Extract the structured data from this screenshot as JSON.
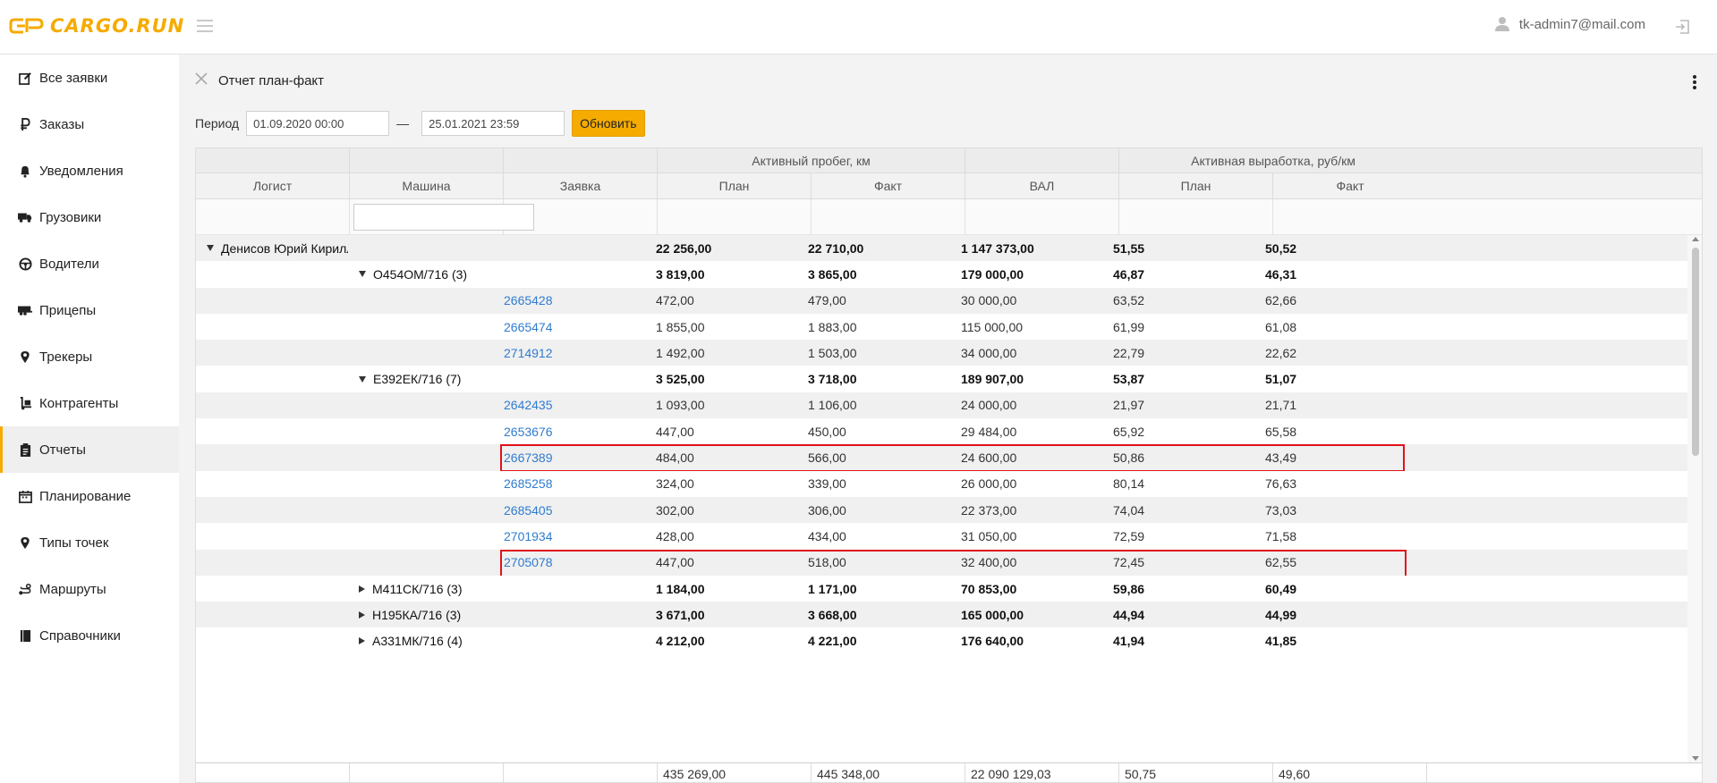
{
  "app": {
    "logo_text": "CARGO.RUN",
    "accent_color": "#f5ab00",
    "user_email": "tk-admin7@mail.com"
  },
  "sidebar": {
    "items": [
      {
        "label": "Все заявки",
        "icon": "edit-icon"
      },
      {
        "label": "Заказы",
        "icon": "ruble-icon"
      },
      {
        "label": "Уведомления",
        "icon": "bell-icon"
      },
      {
        "label": "Грузовики",
        "icon": "truck-icon"
      },
      {
        "label": "Водители",
        "icon": "steering-wheel-icon"
      },
      {
        "label": "Прицепы",
        "icon": "trailer-icon"
      },
      {
        "label": "Трекеры",
        "icon": "map-pin-icon"
      },
      {
        "label": "Контрагенты",
        "icon": "dolly-icon"
      },
      {
        "label": "Отчеты",
        "icon": "clipboard-icon",
        "active": true
      },
      {
        "label": "Планирование",
        "icon": "calendar-icon"
      },
      {
        "label": "Типы точек",
        "icon": "map-pin-icon"
      },
      {
        "label": "Маршруты",
        "icon": "route-icon"
      },
      {
        "label": "Справочники",
        "icon": "book-icon"
      }
    ]
  },
  "report": {
    "title": "Отчет план-факт",
    "period_label": "Период",
    "date_from": "01.09.2020 00:00",
    "date_to": "25.01.2021 23:59",
    "dash": "—",
    "refresh_label": "Обновить"
  },
  "grid": {
    "group_headers": {
      "mileage": "Активный пробег, км",
      "output": "Активная выработка, руб/км"
    },
    "columns": [
      "Логист",
      "Машина",
      "Заявка",
      "План",
      "Факт",
      "ВАЛ",
      "План",
      "Факт"
    ],
    "rows": [
      {
        "level": 0,
        "name": "Денисов Юрий Кириллович",
        "plan": "22 256,00",
        "fact": "22 710,00",
        "val": "1 147 373,00",
        "out_plan": "51,55",
        "out_fact": "50,52"
      },
      {
        "level": 1,
        "name": "О454ОМ/716 (3)",
        "expanded": true,
        "plan": "3 819,00",
        "fact": "3 865,00",
        "val": "179 000,00",
        "out_plan": "46,87",
        "out_fact": "46,31"
      },
      {
        "level": 2,
        "order": "2665428",
        "plan": "472,00",
        "fact": "479,00",
        "val": "30 000,00",
        "out_plan": "63,52",
        "out_fact": "62,66"
      },
      {
        "level": 2,
        "order": "2665474",
        "plan": "1 855,00",
        "fact": "1 883,00",
        "val": "115 000,00",
        "out_plan": "61,99",
        "out_fact": "61,08"
      },
      {
        "level": 2,
        "order": "2714912",
        "plan": "1 492,00",
        "fact": "1 503,00",
        "val": "34 000,00",
        "out_plan": "22,79",
        "out_fact": "22,62"
      },
      {
        "level": 1,
        "name": "Е392ЕК/716 (7)",
        "expanded": true,
        "plan": "3 525,00",
        "fact": "3 718,00",
        "val": "189 907,00",
        "out_plan": "53,87",
        "out_fact": "51,07"
      },
      {
        "level": 2,
        "order": "2642435",
        "plan": "1 093,00",
        "fact": "1 106,00",
        "val": "24 000,00",
        "out_plan": "21,97",
        "out_fact": "21,71"
      },
      {
        "level": 2,
        "order": "2653676",
        "plan": "447,00",
        "fact": "450,00",
        "val": "29 484,00",
        "out_plan": "65,92",
        "out_fact": "65,58"
      },
      {
        "level": 2,
        "order": "2667389",
        "highlighted": true,
        "plan": "484,00",
        "fact": "566,00",
        "val": "24 600,00",
        "out_plan": "50,86",
        "out_fact": "43,49"
      },
      {
        "level": 2,
        "order": "2685258",
        "plan": "324,00",
        "fact": "339,00",
        "val": "26 000,00",
        "out_plan": "80,14",
        "out_fact": "76,63"
      },
      {
        "level": 2,
        "order": "2685405",
        "plan": "302,00",
        "fact": "306,00",
        "val": "22 373,00",
        "out_plan": "74,04",
        "out_fact": "73,03"
      },
      {
        "level": 2,
        "order": "2701934",
        "plan": "428,00",
        "fact": "434,00",
        "val": "31 050,00",
        "out_plan": "72,59",
        "out_fact": "71,58"
      },
      {
        "level": 2,
        "order": "2705078",
        "highlighted": true,
        "plan": "447,00",
        "fact": "518,00",
        "val": "32 400,00",
        "out_plan": "72,45",
        "out_fact": "62,55"
      },
      {
        "level": 1,
        "name": "М411СК/716 (3)",
        "expanded": false,
        "plan": "1 184,00",
        "fact": "1 171,00",
        "val": "70 853,00",
        "out_plan": "59,86",
        "out_fact": "60,49"
      },
      {
        "level": 1,
        "name": "Н195КА/716 (3)",
        "expanded": false,
        "plan": "3 671,00",
        "fact": "3 668,00",
        "val": "165 000,00",
        "out_plan": "44,94",
        "out_fact": "44,99"
      },
      {
        "level": 1,
        "name": "А331МК/716 (4)",
        "expanded": false,
        "plan": "4 212,00",
        "fact": "4 221,00",
        "val": "176 640,00",
        "out_plan": "41,94",
        "out_fact": "41,85"
      }
    ],
    "totals": {
      "plan": "435 269,00",
      "fact": "445 348,00",
      "val": "22 090 129,03",
      "out_plan": "50,75",
      "out_fact": "49,60"
    }
  }
}
